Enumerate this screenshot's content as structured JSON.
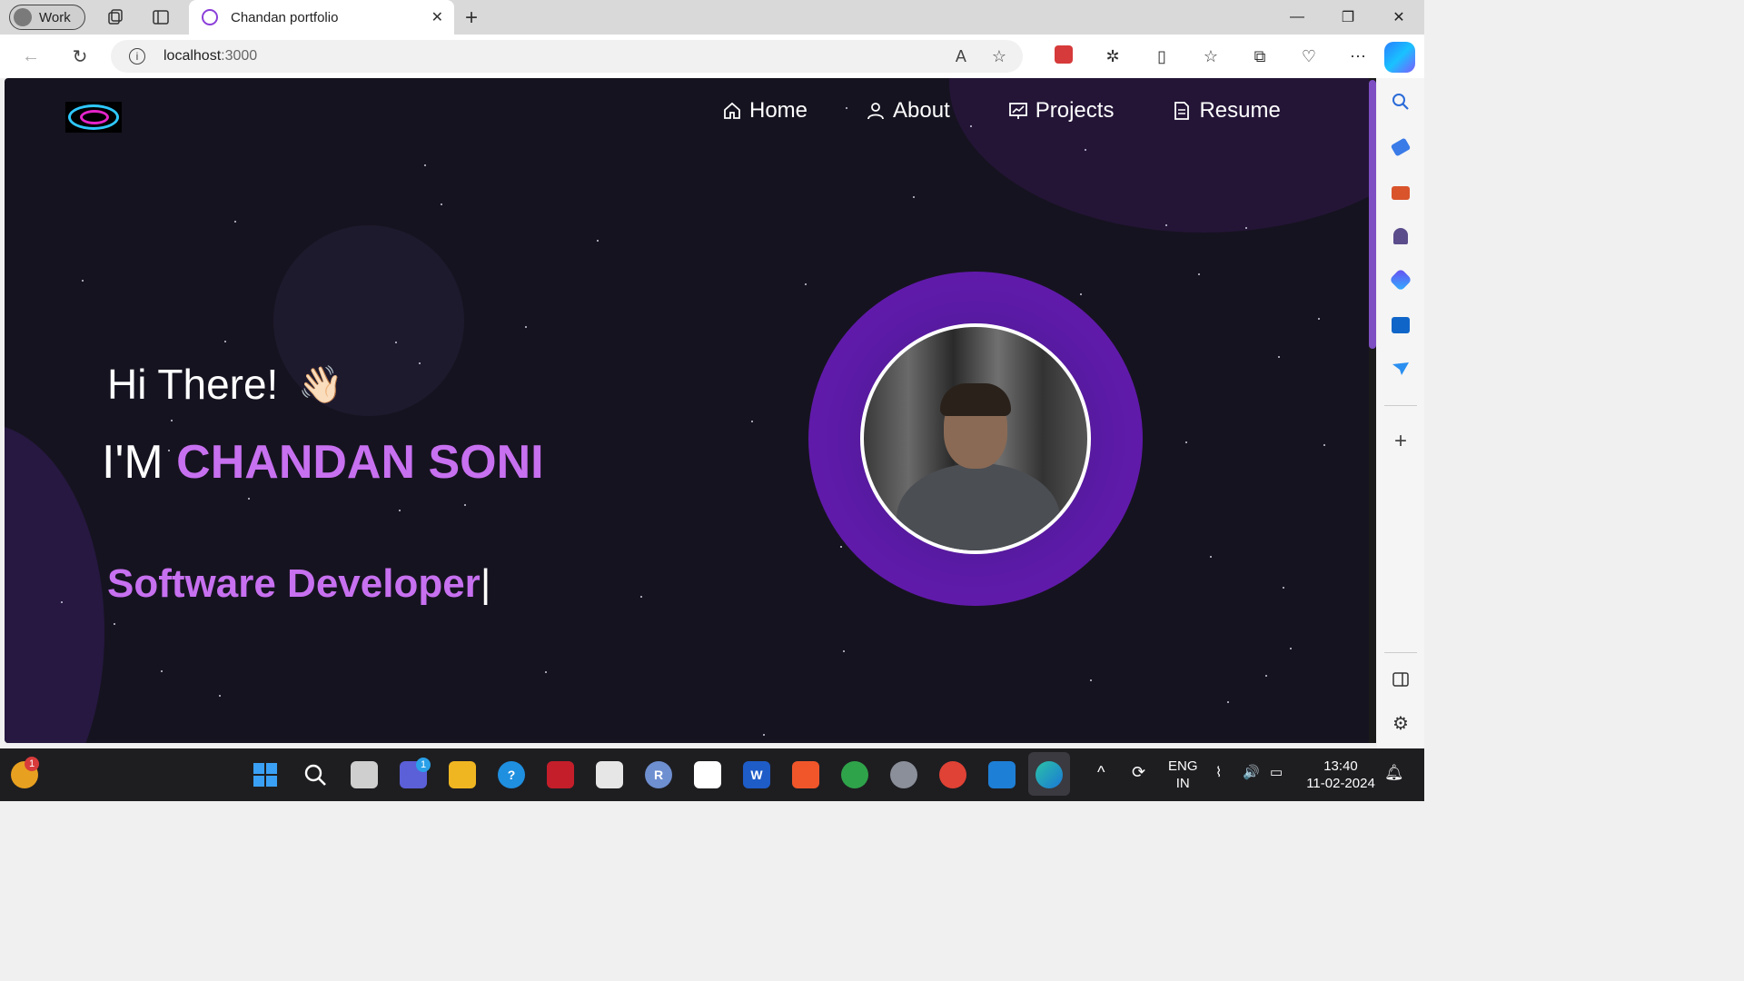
{
  "browser": {
    "profile_label": "Work",
    "tab_title": "Chandan portfolio",
    "url_host": "localhost",
    "url_port": ":3000"
  },
  "site": {
    "nav": [
      {
        "label": "Home",
        "icon": "home-icon"
      },
      {
        "label": "About",
        "icon": "user-icon"
      },
      {
        "label": "Projects",
        "icon": "projects-icon"
      },
      {
        "label": "Resume",
        "icon": "document-icon"
      }
    ],
    "greeting": "Hi There!",
    "wave_emoji": "👋🏻",
    "im_prefix": "I'M",
    "name": "CHANDAN SONI",
    "role": "Software Developer",
    "caret": "|",
    "accent_color": "#c770f0"
  },
  "taskbar": {
    "lang_top": "ENG",
    "lang_bottom": "IN",
    "time": "13:40",
    "date": "11-02-2024",
    "notification_badge": "1",
    "chat_badge": "1"
  }
}
